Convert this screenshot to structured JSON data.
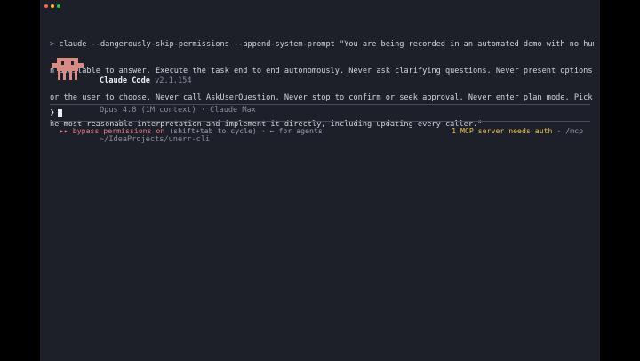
{
  "window": {
    "traffic_lights": [
      {
        "name": "close",
        "color": "#ff5f57"
      },
      {
        "name": "minimize",
        "color": "#febc2e"
      },
      {
        "name": "maximize",
        "color": "#28c840"
      }
    ]
  },
  "terminal": {
    "prompt_symbol": ">",
    "command_lines": [
      "claude --dangerously-skip-permissions --append-system-prompt \"You are being recorded in an automated demo with no huma",
      "n available to answer. Execute the task end to end autonomously. Never ask clarifying questions. Never present options f",
      "or the user to choose. Never call AskUserQuestion. Never stop to confirm or seek approval. Never enter plan mode. Pick t",
      "he most reasonable interpretation and implement it directly, including updating every caller.\""
    ]
  },
  "banner": {
    "mascot_icon": "claude-mascot-icon",
    "mascot_color": "#d98a85",
    "product": "Claude Code",
    "version": "v2.1.154",
    "model_line": "Opus 4.8 (1M context) · Claude Max",
    "path": "~/IdeaProjects/unerr-cli"
  },
  "input": {
    "prompt_symbol": "❯",
    "value": ""
  },
  "status_bar": {
    "mode_icon": "▸▸",
    "mode_label": "bypass permissions on",
    "mode_hint": "(shift+tab to cycle) · ← for agents",
    "mcp_warning": "1 MCP server needs auth",
    "mcp_hint": "· /mcp",
    "colors": {
      "mode": "#f07b86",
      "warning": "#e8c34f"
    }
  }
}
